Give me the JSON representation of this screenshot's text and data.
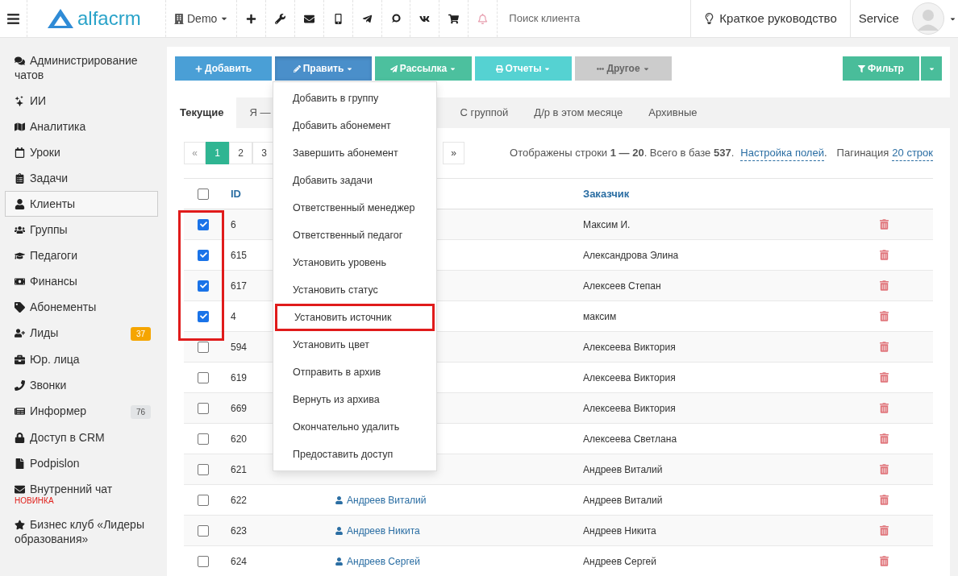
{
  "topbar": {
    "brand": "alfacrm",
    "company": "Demo",
    "search": {
      "placeholder": "Поиск клиента"
    },
    "guide": "Краткое руководство",
    "user": "Service"
  },
  "sidebar": {
    "items": [
      {
        "label": "Администрирование чатов",
        "selected": false
      },
      {
        "label": "ИИ",
        "selected": false
      },
      {
        "label": "Аналитика",
        "selected": false
      },
      {
        "label": "Уроки",
        "selected": false
      },
      {
        "label": "Задачи",
        "selected": false
      },
      {
        "label": "Клиенты",
        "selected": true
      },
      {
        "label": "Группы",
        "selected": false
      },
      {
        "label": "Педагоги",
        "selected": false
      },
      {
        "label": "Финансы",
        "selected": false
      },
      {
        "label": "Абонементы",
        "selected": false
      },
      {
        "label": "Лиды",
        "selected": false,
        "badge": {
          "text": "37",
          "color": "#f5a500"
        }
      },
      {
        "label": "Юр. лица",
        "selected": false
      },
      {
        "label": "Звонки",
        "selected": false
      },
      {
        "label": "Информер",
        "selected": false,
        "badge": {
          "text": "76",
          "color": "#e2e4e6"
        }
      },
      {
        "label": "Доступ в CRM",
        "selected": false
      },
      {
        "label": "Podpislon",
        "selected": false
      },
      {
        "label": "Внутренний чат",
        "selected": false,
        "note": "НОВИНКА"
      },
      {
        "label": "Бизнес клуб «Лидеры образования»",
        "selected": false
      }
    ]
  },
  "actions": [
    {
      "kind": "add",
      "label": "Добавить",
      "color": "#4a9fd6",
      "disabled": false,
      "expanded": false
    },
    {
      "kind": "edit",
      "label": "Править",
      "color": "#4a8fca",
      "disabled": false,
      "expanded": true
    },
    {
      "kind": "mail",
      "label": "Рассылка",
      "color": "#4cc09e",
      "disabled": false,
      "expanded": false
    },
    {
      "kind": "print",
      "label": "Отчеты",
      "color": "#55d2d2",
      "disabled": false,
      "expanded": false
    },
    {
      "kind": "more",
      "label": "Другое",
      "color": "#cccccc",
      "disabled": true,
      "expanded": false
    }
  ],
  "filter": {
    "label": "Фильтр"
  },
  "tabs": [
    {
      "label": "Текущие",
      "selected": true
    },
    {
      "label": "Я —",
      "selected": false
    },
    {
      "label": "С группой",
      "selected": false
    },
    {
      "label": "Д/р в этом месяце",
      "selected": false
    },
    {
      "label": "Архивные",
      "selected": false
    }
  ],
  "pagination": {
    "pages": [
      {
        "kind": "prev",
        "label": "«",
        "selected": false
      },
      {
        "kind": "page",
        "label": "1",
        "selected": true
      },
      {
        "kind": "page",
        "label": "2",
        "selected": false
      },
      {
        "kind": "page",
        "label": "3",
        "selected": false
      },
      {
        "kind": "next",
        "label": "»",
        "selected": false
      }
    ],
    "summary": "Отображены строки **1 — 20**. Всего в базе **537**.",
    "fields_link": "Настройка полей",
    "after_link": ".",
    "page_size_label": "Пагинация",
    "page_size_link": "20 строк"
  },
  "table": {
    "select_all": false,
    "id_header": "ID",
    "customer_header": "Заказчик",
    "frame_checked": true,
    "rows": [
      {
        "checked": true,
        "id": "6",
        "customer": "Максим И."
      },
      {
        "checked": true,
        "id": "615",
        "customer": "Александрова Элина"
      },
      {
        "checked": true,
        "id": "617",
        "customer": "Алексеев Степан"
      },
      {
        "checked": true,
        "id": "4",
        "customer": "максим"
      },
      {
        "checked": false,
        "id": "594",
        "customer": "Алексеева Виктория"
      },
      {
        "checked": false,
        "id": "619",
        "customer": "Алексеева Виктория"
      },
      {
        "checked": false,
        "id": "669",
        "customer": "Алексеева Виктория"
      },
      {
        "checked": false,
        "id": "620",
        "customer": "Алексеева Светлана"
      },
      {
        "checked": false,
        "id": "621",
        "customer": "Андреев Виталий"
      },
      {
        "checked": false,
        "id": "622",
        "name": "Андреев Виталий",
        "customer": "Андреев Виталий"
      },
      {
        "checked": false,
        "id": "623",
        "name": "Андреев Никита",
        "customer": "Андреев Никита"
      },
      {
        "checked": false,
        "id": "624",
        "name": "Андреев Сергей",
        "customer": "Андреев Сергей"
      }
    ]
  },
  "edit_menu": {
    "items": [
      {
        "label": "Добавить в группу",
        "framed": false
      },
      {
        "label": "Добавить абонемент",
        "framed": false
      },
      {
        "label": "Завершить абонемент",
        "framed": false
      },
      {
        "label": "Добавить задачи",
        "framed": false
      },
      {
        "label": "Ответственный менеджер",
        "framed": false
      },
      {
        "label": "Ответственный педагог",
        "framed": false
      },
      {
        "label": "Установить уровень",
        "framed": false
      },
      {
        "label": "Установить статус",
        "framed": false
      },
      {
        "label": "Установить источник",
        "framed": true
      },
      {
        "label": "Установить цвет",
        "framed": false
      },
      {
        "label": "Отправить в архив",
        "framed": false
      },
      {
        "label": "Вернуть из архива",
        "framed": false
      },
      {
        "label": "Окончательно удалить",
        "framed": false
      },
      {
        "label": "Предоставить доступ",
        "framed": false
      }
    ]
  }
}
